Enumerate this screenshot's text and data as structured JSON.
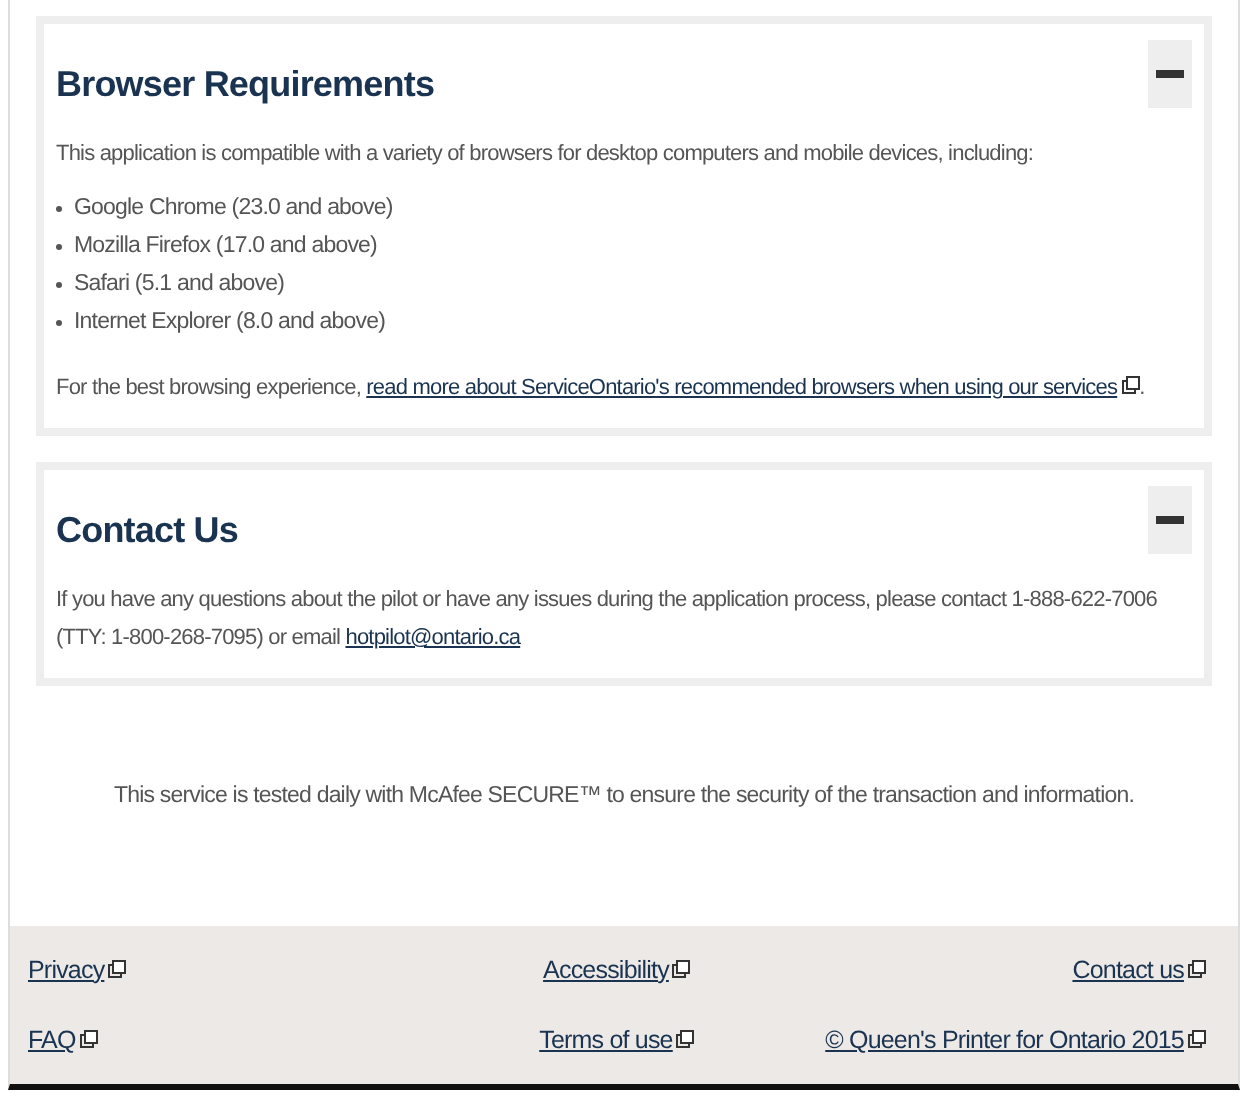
{
  "panels": [
    {
      "kind": "list",
      "title": "Browser Requirements",
      "expanded": true,
      "intro": "This application is compatible with a variety of browsers for desktop computers and mobile devices, including:",
      "items": [
        "Google Chrome (23.0 and above)",
        "Mozilla Firefox (17.0 and above)",
        "Safari (5.1 and above)",
        "Internet Explorer (8.0 and above)"
      ],
      "before": "For the best browsing experience, ",
      "link": "read more about ServiceOntario's recommended browsers when using our services",
      "after": "."
    },
    {
      "kind": "text",
      "title": "Contact Us",
      "expanded": true,
      "before": "If you have any questions about the pilot or have any issues during the application process, please contact 1-888-622-7006 (TTY: 1-800-268-7095) or email ",
      "link": "hotpilot@ontario.ca"
    }
  ],
  "security_note": "This service is tested daily with McAfee SECURE™ to ensure the security of the transaction and information.",
  "footer_links": [
    {
      "label": "Privacy"
    },
    {
      "label": "Accessibility"
    },
    {
      "label": "Contact us"
    },
    {
      "label": "FAQ"
    },
    {
      "label": "Terms of use"
    },
    {
      "label": "© Queen's Printer for Ontario 2015"
    }
  ]
}
